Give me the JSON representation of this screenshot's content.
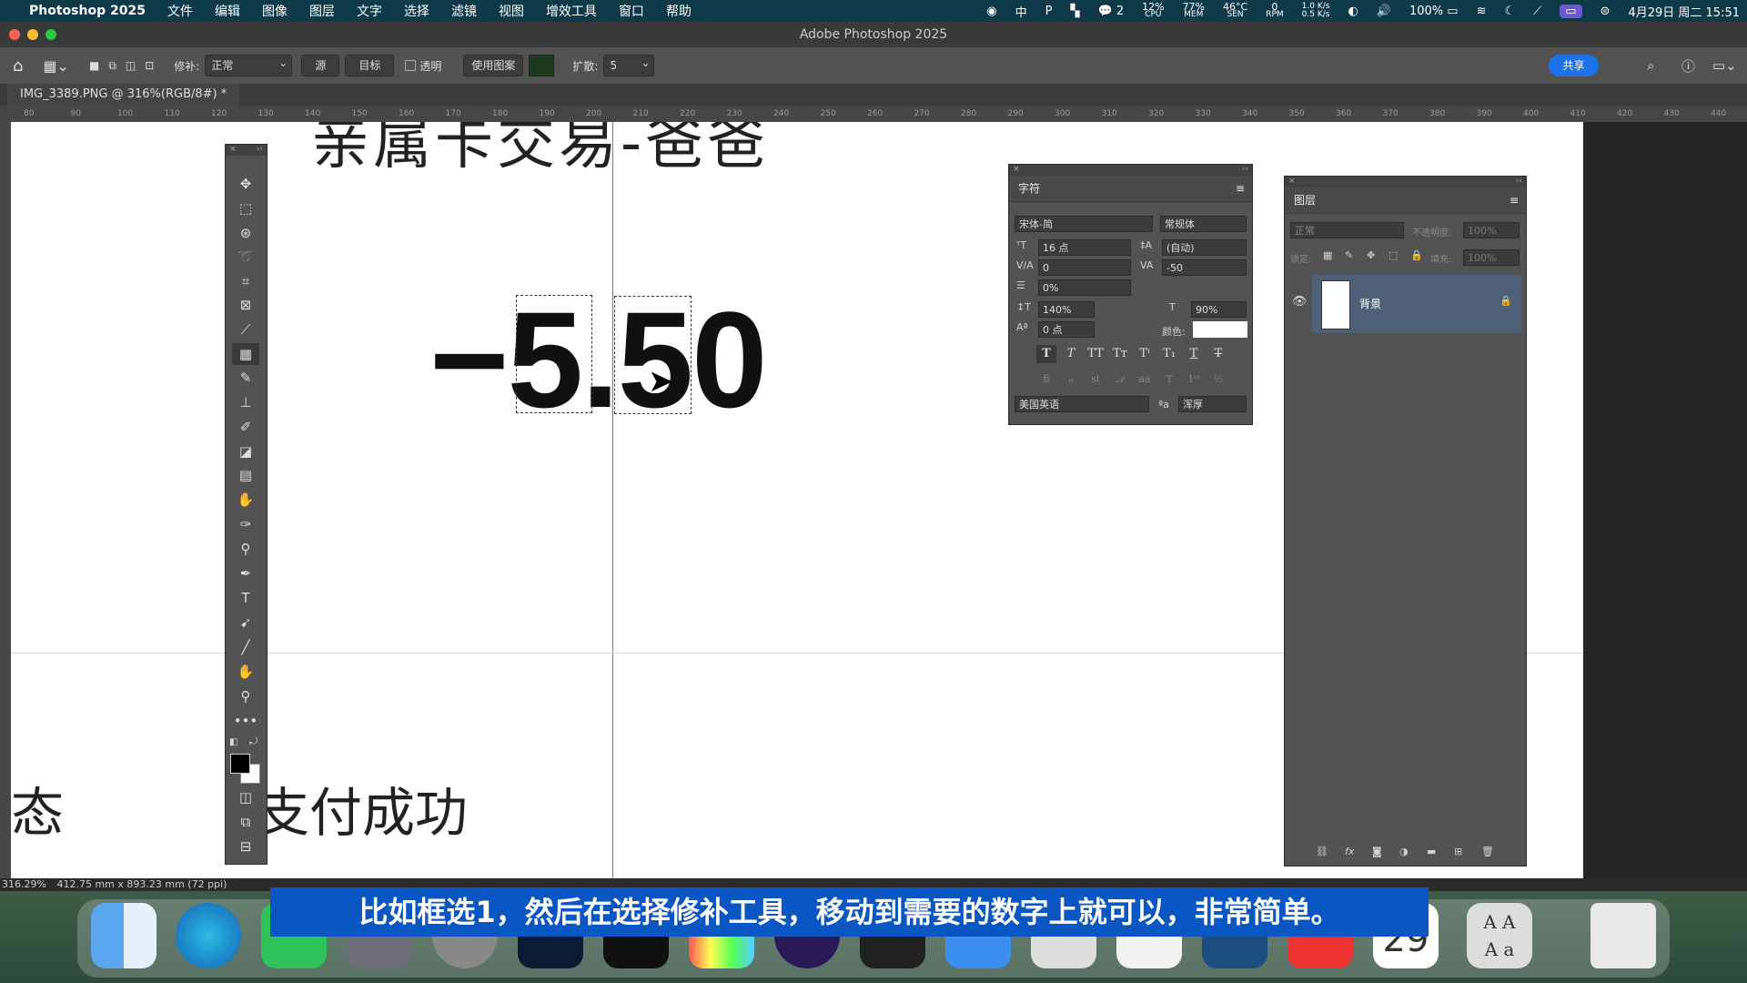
{
  "menubar": {
    "app": "Photoshop 2025",
    "menus": [
      "文件",
      "编辑",
      "图像",
      "图层",
      "文字",
      "选择",
      "滤镜",
      "视图",
      "增效工具",
      "窗口",
      "帮助"
    ],
    "wechat_count": "2",
    "cpu": "12%",
    "cpu_lbl": "CPU",
    "mem": "77%",
    "mem_lbl": "MEM",
    "sen": "46°C",
    "sen_lbl": "SEN",
    "rpm": "0",
    "rpm_lbl": "RPM",
    "net_up": "1.0 K/s",
    "net_down": "0.5 K/s",
    "battery": "100%",
    "datetime": "4月29日 周二  15:51"
  },
  "window": {
    "title": "Adobe Photoshop 2025"
  },
  "options": {
    "patch_label": "修补:",
    "patch_mode": "正常",
    "source": "源",
    "target": "目标",
    "transparent": "透明",
    "use_pattern": "使用图案",
    "diffusion_label": "扩散:",
    "diffusion_value": "5",
    "share": "共享"
  },
  "doc_tab": "IMG_3389.PNG @ 316%(RGB/8#) *",
  "ruler_ticks": [
    "80",
    "90",
    "100",
    "110",
    "120",
    "130",
    "140",
    "150",
    "160",
    "170",
    "180",
    "190",
    "200",
    "210",
    "220",
    "230",
    "240",
    "250",
    "260",
    "270",
    "280",
    "290",
    "300",
    "310",
    "320",
    "330",
    "340",
    "350",
    "360",
    "370",
    "380",
    "390",
    "400",
    "410",
    "420",
    "430",
    "440"
  ],
  "canvas": {
    "top_text": "亲属卡交易-爸爸",
    "amount": "−5.50",
    "status_left": "态",
    "status_text": "支付成功"
  },
  "status": {
    "zoom": "316.29%",
    "info": "412.75 mm x 893.23 mm (72 ppi)"
  },
  "character": {
    "title": "字符",
    "font_family": "宋体-简",
    "font_style": "常规体",
    "size": "16 点",
    "leading": "(自动)",
    "kerning": "0",
    "tracking": "-50",
    "tsume": "0%",
    "vscale": "140%",
    "hscale": "90%",
    "baseline": "0 点",
    "color_label": "颜色:",
    "language": "美国英语",
    "antialias": "浑厚",
    "aa_symbol": "ªa"
  },
  "layers": {
    "title": "图层",
    "blend": "正常",
    "opacity_label": "不透明度:",
    "opacity": "100%",
    "lock_label": "锁定:",
    "fill_label": "填充:",
    "fill": "100%",
    "layer_name": "背景"
  },
  "subtitle": "比如框选1，然后在选择修补工具，移动到需要的数字上就可以，非常简单。",
  "dock": {
    "calendar_day": "29",
    "font_app": "A A\nA a"
  }
}
